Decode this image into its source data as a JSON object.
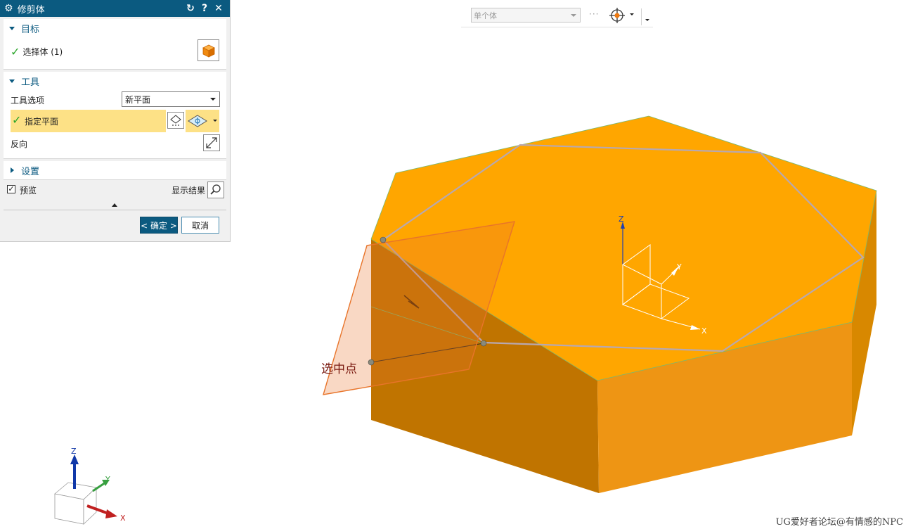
{
  "dialog": {
    "title": "修剪体",
    "title_icon": "gear-icon",
    "buttons": {
      "reset": "↻",
      "help": "?",
      "close": "✕"
    },
    "target": {
      "heading": "目标",
      "select_body_label": "选择体 (1)"
    },
    "tool": {
      "heading": "工具",
      "option_label": "工具选项",
      "option_value": "新平面",
      "specify_plane_label": "指定平面",
      "reverse_label": "反向"
    },
    "settings": {
      "heading": "设置"
    },
    "preview_label": "预览",
    "preview_checked": true,
    "show_result_label": "显示结果",
    "ok_label": "< 确定 >",
    "cancel_label": "取消"
  },
  "toolbar": {
    "select_filter": "单个体",
    "snap_icon": "snap-point-icon"
  },
  "viewport": {
    "annotation": "选中点",
    "wcs_axes": {
      "x": "X",
      "y": "Y",
      "z": "Z"
    },
    "triad_axes": {
      "x": "X",
      "y": "Y",
      "z": "Z"
    },
    "body_color": "#ffa600",
    "plane_color": "#e8742a"
  },
  "watermark": "UG爱好者论坛@有情感的NPC"
}
